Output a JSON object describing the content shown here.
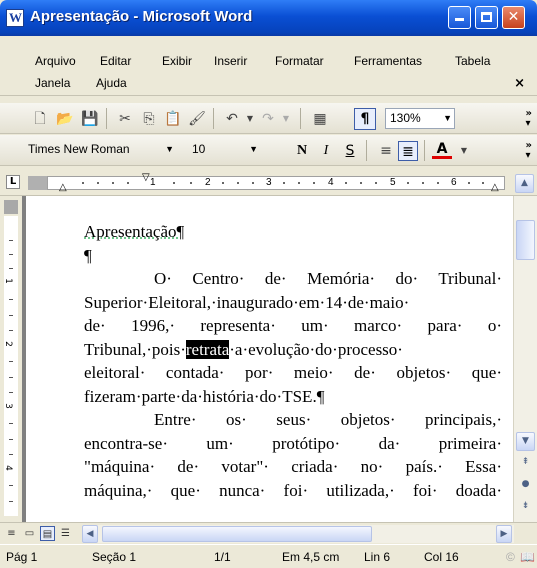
{
  "window": {
    "title": "Apresentação - Microsoft Word"
  },
  "menu": {
    "items": [
      "Arquivo",
      "Editar",
      "Exibir",
      "Inserir",
      "Formatar",
      "Ferramentas",
      "Tabela",
      "Janela",
      "Ajuda"
    ],
    "close": "×"
  },
  "standard_toolbar": {
    "zoom": "130%",
    "pilcrow": "¶"
  },
  "format_toolbar": {
    "font": "Times New Roman",
    "size": "10",
    "bold": "N",
    "italic": "I",
    "underline": "S",
    "font_color_label": "A"
  },
  "ruler": {
    "tab_selector": "L",
    "numbers": [
      "1",
      "2",
      "3",
      "4",
      "5",
      "6"
    ]
  },
  "vruler": {
    "numbers": [
      "1",
      "2",
      "3",
      "4"
    ]
  },
  "document": {
    "title_line": "Apresentação¶",
    "empty_para": "¶",
    "p1_l1": "O· Centro· de· Memória· do· Tribunal·",
    "p1_l2": "Superior·Eleitoral,·inaugurado·em·14·de·maio·",
    "p1_l3": "de· 1996,· representa· um· marco· para· o·",
    "p1_l4_a": "Tribunal,·pois·",
    "p1_l4_sel": "retrata",
    "p1_l4_b": "·a·evolução·do·processo·",
    "p1_l5": "eleitoral· contada· por· meio· de· objetos· que·",
    "p1_l6": "fizeram·parte·da·história·do·TSE.¶",
    "p2_l1": "Entre· os· seus· objetos· principais,·",
    "p2_l2": "encontra-se· um· protótipo· da· primeira·",
    "p2_l3": "\"máquina· de· votar\"· criada· no· país.· Essa·",
    "p2_l4": "máquina,· que· nunca· foi· utilizada,· foi· doada·"
  },
  "status": {
    "page": "Pág 1",
    "section": "Seção 1",
    "pages": "1/1",
    "at": "Em 4,5 cm",
    "line": "Lin 6",
    "col": "Col 16"
  }
}
